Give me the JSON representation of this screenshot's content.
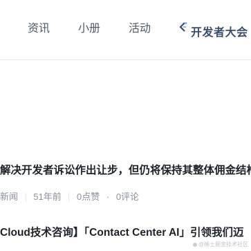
{
  "nav": {
    "items": [
      {
        "label": "资讯"
      },
      {
        "label": "小册"
      },
      {
        "label": "活动"
      }
    ],
    "conference": {
      "label": "开发者大会",
      "icon": "conference-logo-icon"
    }
  },
  "articles": [
    {
      "title": "解决开发者诉讼作出让步，但仍将保持其整体佣金结构",
      "meta": {
        "category": "新闻",
        "time": "51年前",
        "likes": "0点赞",
        "comments": "0评论"
      }
    },
    {
      "title": "Cloud技术咨询】「Contact Center AI」引领我们迈"
    }
  ],
  "watermark": "@稀土掘金技术社区",
  "colors": {
    "nav_text": "#515767",
    "title_text": "#1d2129",
    "meta_text": "#8a919f",
    "conference_accent": "#3a4d6b"
  }
}
